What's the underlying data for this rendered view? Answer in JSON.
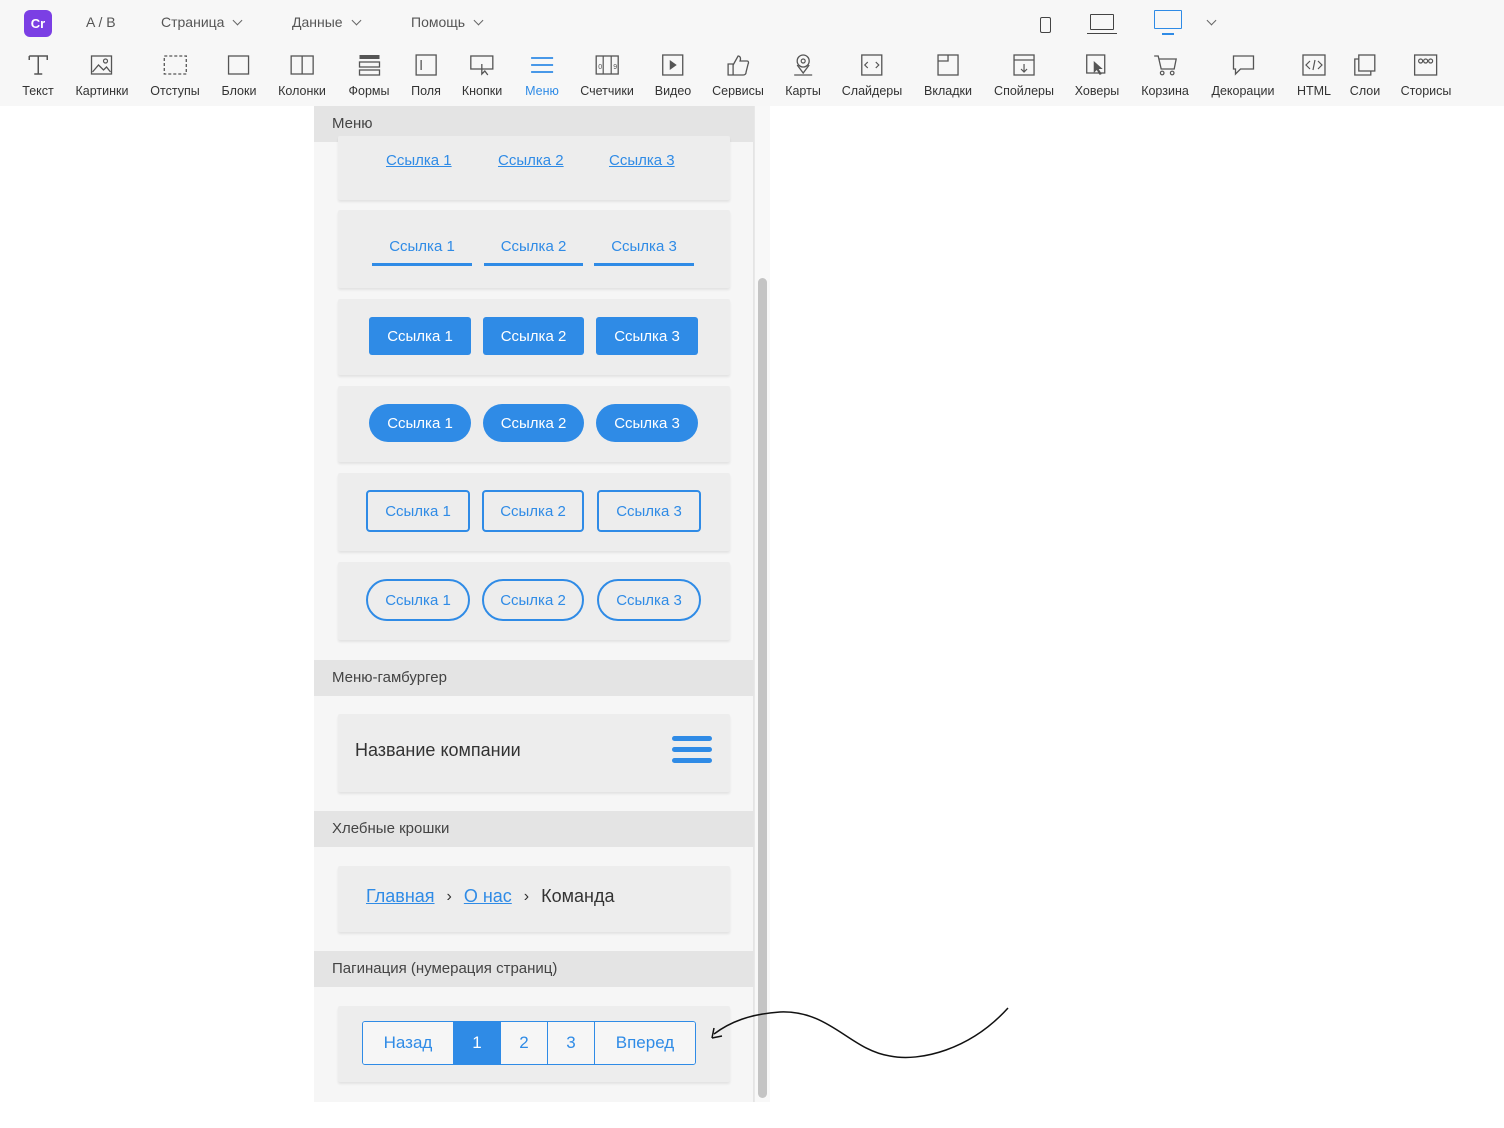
{
  "topbar": {
    "logo_text": "Cr",
    "menus": [
      {
        "label": "A / B",
        "dropdown": false
      },
      {
        "label": "Страница",
        "dropdown": true
      },
      {
        "label": "Данные",
        "dropdown": true
      },
      {
        "label": "Помощь",
        "dropdown": true
      }
    ],
    "device_icons": [
      "phone-icon",
      "laptop-icon",
      "desktop-icon"
    ],
    "active_device": "desktop",
    "accent_color": "#2f8be6"
  },
  "toolbar": {
    "items": [
      {
        "label": "Текст",
        "icon": "text-icon"
      },
      {
        "label": "Картинки",
        "icon": "image-icon"
      },
      {
        "label": "Отступы",
        "icon": "padding-icon"
      },
      {
        "label": "Блоки",
        "icon": "block-icon"
      },
      {
        "label": "Колонки",
        "icon": "columns-icon"
      },
      {
        "label": "Формы",
        "icon": "forms-icon"
      },
      {
        "label": "Поля",
        "icon": "fields-icon"
      },
      {
        "label": "Кнопки",
        "icon": "buttons-icon"
      },
      {
        "label": "Меню",
        "icon": "menu-icon",
        "active": true
      },
      {
        "label": "Счетчики",
        "icon": "counter-icon"
      },
      {
        "label": "Видео",
        "icon": "video-icon"
      },
      {
        "label": "Сервисы",
        "icon": "services-icon"
      },
      {
        "label": "Карты",
        "icon": "map-icon"
      },
      {
        "label": "Слайдеры",
        "icon": "slider-icon"
      },
      {
        "label": "Вкладки",
        "icon": "tabs-icon"
      },
      {
        "label": "Спойлеры",
        "icon": "spoiler-icon"
      },
      {
        "label": "Ховеры",
        "icon": "hover-icon"
      },
      {
        "label": "Корзина",
        "icon": "cart-icon"
      },
      {
        "label": "Декорации",
        "icon": "decoration-icon"
      },
      {
        "label": "HTML",
        "icon": "html-icon"
      },
      {
        "label": "Слои",
        "icon": "layers-icon"
      },
      {
        "label": "Сторисы",
        "icon": "stories-icon"
      }
    ]
  },
  "panel": {
    "sections": {
      "menu": "Меню",
      "hamburger": "Меню-гамбургер",
      "breadcrumbs": "Хлебные крошки",
      "pagination": "Пагинация (нумерация страниц)"
    },
    "menu_links": [
      "Ссылка 1",
      "Ссылка 2",
      "Ссылка 3"
    ],
    "hamburger": {
      "company_name": "Название компании"
    },
    "breadcrumbs": {
      "items": [
        "Главная",
        "О нас",
        "Команда"
      ],
      "separator": "›"
    },
    "pagination": {
      "prev": "Назад",
      "pages": [
        "1",
        "2",
        "3"
      ],
      "current": "1",
      "next": "Вперед"
    }
  }
}
